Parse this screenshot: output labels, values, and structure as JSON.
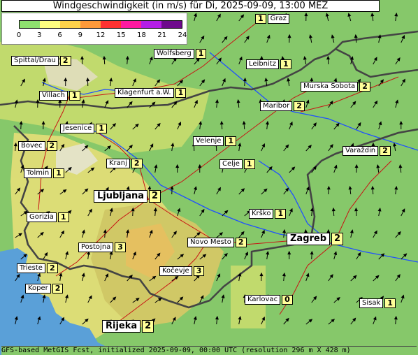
{
  "title": "Windgeschwindigkeit (in m/s) für Di, 2025-09-09, 13:00 MEZ",
  "legend": {
    "ticks": [
      "0",
      "3",
      "6",
      "9",
      "12",
      "15",
      "18",
      "21",
      "24"
    ],
    "colors": [
      "#8ee06e",
      "#ffff80",
      "#ffd24a",
      "#ff9a3a",
      "#ff3232",
      "#ff1aa0",
      "#b41ee6",
      "#6e0a8c"
    ]
  },
  "cities": [
    {
      "name": "Graz",
      "value": "1"
    },
    {
      "name": "Wolfsberg",
      "value": "1"
    },
    {
      "name": "Spittal/Drau",
      "value": "2"
    },
    {
      "name": "Leibnitz",
      "value": "1"
    },
    {
      "name": "Murska Sobota",
      "value": "2"
    },
    {
      "name": "Villach",
      "value": "1"
    },
    {
      "name": "Klagenfurt a.W.",
      "value": "1"
    },
    {
      "name": "Maribor",
      "value": "2"
    },
    {
      "name": "Jesenice",
      "value": "1"
    },
    {
      "name": "Velenje",
      "value": "1"
    },
    {
      "name": "Bovec",
      "value": "2"
    },
    {
      "name": "Varaždin",
      "value": "2"
    },
    {
      "name": "Kranj",
      "value": "2"
    },
    {
      "name": "Celje",
      "value": "1"
    },
    {
      "name": "Tolmin",
      "value": "1"
    },
    {
      "name": "Ljubljana",
      "value": "2"
    },
    {
      "name": "Krško",
      "value": "1"
    },
    {
      "name": "Gorizia",
      "value": "1"
    },
    {
      "name": "Postojna",
      "value": "3"
    },
    {
      "name": "Novo Mesto",
      "value": "2"
    },
    {
      "name": "Zagreb",
      "value": "2"
    },
    {
      "name": "Trieste",
      "value": "2"
    },
    {
      "name": "Kočevje",
      "value": "3"
    },
    {
      "name": "Koper",
      "value": "2"
    },
    {
      "name": "Karlovac",
      "value": "0"
    },
    {
      "name": "Sisak",
      "value": "1"
    },
    {
      "name": "Rijeka",
      "value": "2"
    }
  ],
  "footer": "GFS-based MetGIS Fcst, initialized 2025-09-09, 00:00 UTC  (resolution 296 m X 428 m)",
  "colors": {
    "land": "#86c86a",
    "terrain": "#e6df78",
    "sea": "#5aa0d8",
    "border": "#444444",
    "river": "#2050ff",
    "road": "#c81414"
  }
}
